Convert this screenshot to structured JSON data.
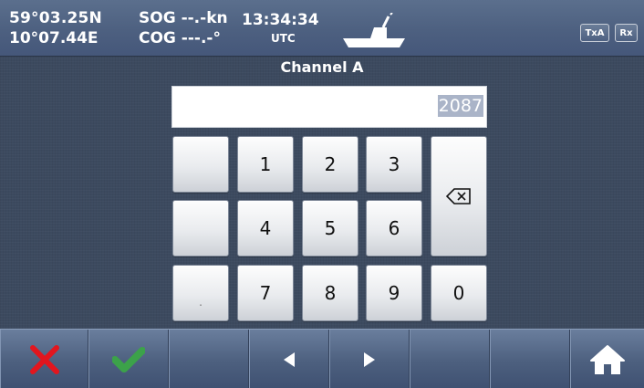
{
  "status": {
    "lat": "59°03.25N",
    "lon": "10°07.44E",
    "sog": "SOG --.-kn",
    "cog": "COG ---.-°",
    "time": "13:34:34",
    "time_zone": "UTC",
    "icons": {
      "ship": "ship-icon"
    },
    "badges": {
      "txa": "TxA",
      "rx": "Rx"
    }
  },
  "dialog": {
    "title": "Channel A",
    "entry_value": "2087"
  },
  "keypad": {
    "keys": {
      "k1": "1",
      "k2": "2",
      "k3": "3",
      "k4": "4",
      "k5": "5",
      "k6": "6",
      "k7": "7",
      "k8": "8",
      "k9": "9",
      "k0": "0",
      "dot": "."
    },
    "icons": {
      "backspace": "backspace-icon"
    }
  },
  "toolbar": {
    "icons": [
      "cancel-icon",
      "confirm-icon",
      "",
      "arrow-left-icon",
      "arrow-right-icon",
      "",
      "",
      "home-icon"
    ]
  },
  "colors": {
    "cancel": "#e2161e",
    "confirm": "#3ca24a",
    "statusbar": "#4d6080",
    "background": "#3c4a5f"
  }
}
